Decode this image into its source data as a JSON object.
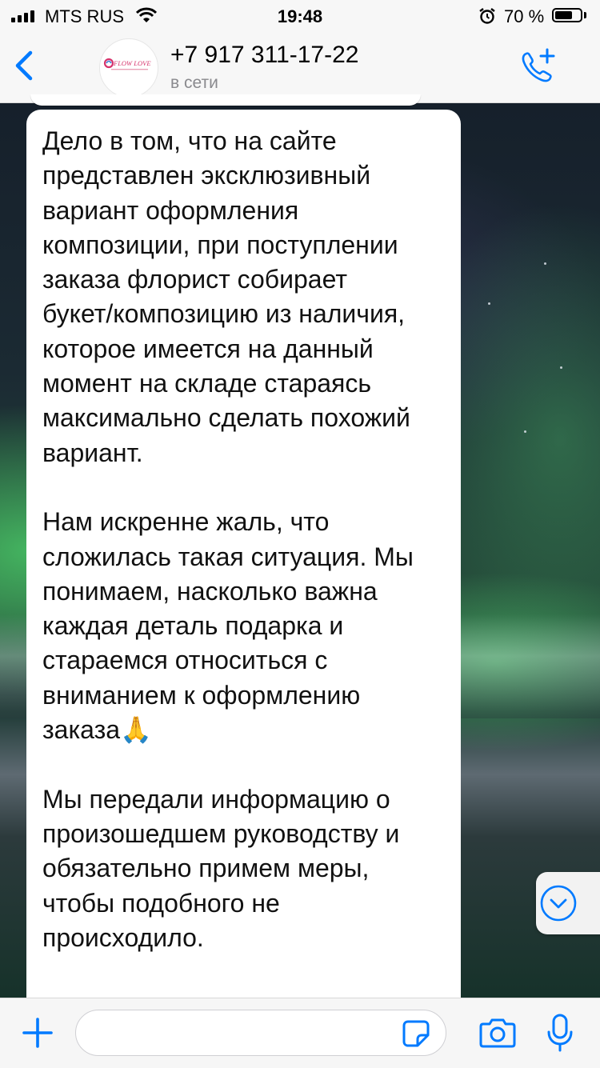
{
  "status_bar": {
    "carrier": "MTS RUS",
    "time": "19:48",
    "battery_percent": "70 %",
    "battery_level": 0.7
  },
  "header": {
    "contact_name": "+7 917 311-17-22",
    "contact_status": "в сети",
    "avatar_logo_text": "FLOW LOVE"
  },
  "message": {
    "text": "Дело в том, что на сайте\nпредставлен эксклюзивный\nвариант оформления\nкомпозиции, при поступлении\nзаказа флорист собирает\nбукет/композицию из наличия,\nкоторое имеется на данный\nмомент на складе стараясь\nмаксимально сделать похожий\nвариант.\n\nНам искренне жаль, что\nсложилась такая ситуация. Мы\nпонимаем, насколько важна\nкаждая деталь подарка и\nстараемся относиться с\nвниманием к оформлению\nзаказа🙏\n\nМы передали информацию о\nпроизошедшем руководству и\nобязательно примем меры,\nчтобы подобного не\nпроисходило."
  },
  "input": {
    "value": "",
    "placeholder": ""
  },
  "icons": {
    "back": "chevron-left-icon",
    "call": "phone-plus-icon",
    "scroll": "chevron-down-circle-icon",
    "attach": "plus-icon",
    "sticker": "sticker-icon",
    "camera": "camera-icon",
    "mic": "microphone-icon"
  },
  "colors": {
    "accent": "#007aff",
    "bubble": "#ffffff",
    "bar_background": "#f7f7f7"
  }
}
